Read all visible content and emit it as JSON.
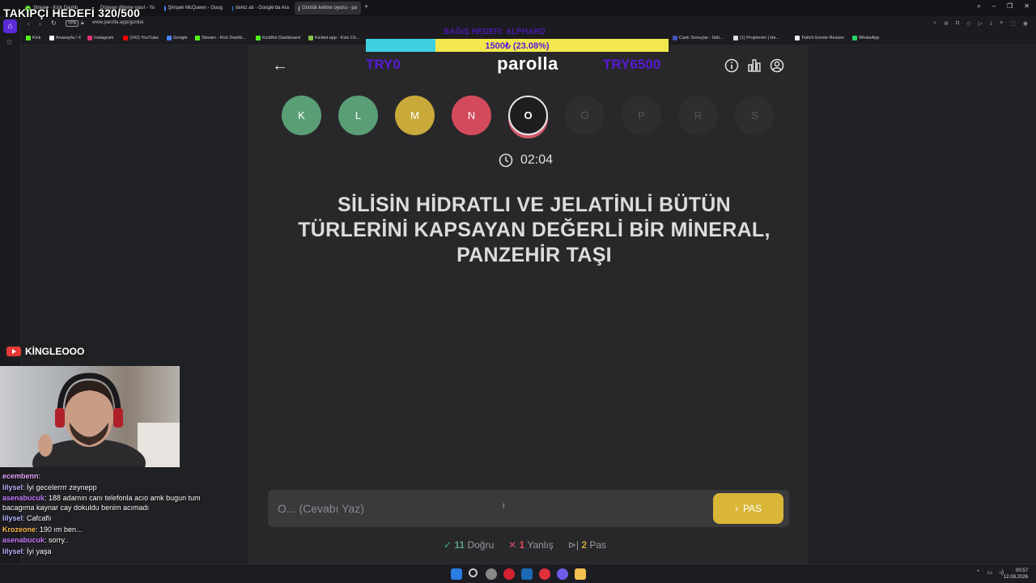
{
  "overlay": {
    "follow_goal": "TAKİPÇİ HEDEFİ 320/500",
    "donation_title": "BAĞIŞ HEDEFİ: ALPHARD",
    "donation_text": "1500₺ (23.08%)",
    "donation_progress": 0.2308,
    "channel_name": "KİNGLEOOO"
  },
  "browser": {
    "tabs": [
      {
        "title": "Stream - Kick Dashb"
      },
      {
        "title": "Dünyan dönme nasıl - Yo"
      },
      {
        "title": "Şimşek McQueen - Goog"
      },
      {
        "title": "deniz atı - Google'da Ara"
      },
      {
        "title": "Günlük kelime oyunu - pa",
        "active": true
      }
    ],
    "vpn": "VPN",
    "url": "www.parolla.app/gunluk",
    "bookmarks": [
      {
        "label": "Kick",
        "color": "#53fc18"
      },
      {
        "label": "Anasayfa / X",
        "color": "#ffffff"
      },
      {
        "label": "Instagram",
        "color": "#e1306c"
      },
      {
        "label": "(242) YouTube",
        "color": "#ff0000"
      },
      {
        "label": "Google",
        "color": "#4285f4"
      },
      {
        "label": "Stream - Kick Dashb...",
        "color": "#53fc18"
      },
      {
        "label": "KickBot Dashboard",
        "color": "#53fc18"
      },
      {
        "label": "Kicklet.app - Kick Ch...",
        "color": "#8bc34a"
      },
      {
        "label": "Canlı Sonuçlar - İddi...",
        "color": "#3f51b5"
      },
      {
        "label": "(1) Projelerim | He...",
        "color": "#dddddd"
      },
      {
        "label": "Twitch Emote Resizer",
        "color": "#eeeeee"
      },
      {
        "label": "WhatsApp",
        "color": "#25d366"
      }
    ]
  },
  "game": {
    "logo": "parolla",
    "try_left": "TRY0",
    "try_right": "TRY6500",
    "letters": [
      {
        "char": "K",
        "state": "green"
      },
      {
        "char": "L",
        "state": "green"
      },
      {
        "char": "M",
        "state": "yellow"
      },
      {
        "char": "N",
        "state": "red"
      },
      {
        "char": "O",
        "state": "current"
      },
      {
        "char": "Ö",
        "state": "pending"
      },
      {
        "char": "P",
        "state": "pending"
      },
      {
        "char": "R",
        "state": "pending"
      },
      {
        "char": "S",
        "state": "pending"
      }
    ],
    "timer": "02:04",
    "question": "SİLİSİN HİDRATLI VE JELATİNLİ BÜTÜN TÜRLERİNİ KAPSAYAN DEĞERLİ BİR MİNERAL, PANZEHİR TAŞI",
    "answer_placeholder": "O... (Cevabı Yaz)",
    "pas_label": "PAS",
    "stats": {
      "correct_count": "11",
      "correct_label": "Doğru",
      "wrong_count": "1",
      "wrong_label": "Yanlış",
      "pass_count": "2",
      "pass_label": "Pas"
    }
  },
  "chat": [
    {
      "user": "ecembenn",
      "message": "",
      "color": "#e6a6ff"
    },
    {
      "user": "lilysel",
      "message": "İyi gecelerrrr zeynepp",
      "color": "#b5b5ff"
    },
    {
      "user": "asenabucuk",
      "message": "188 adamın canı telefonla acıo amk bugun tum bacagıma kaynar cay dokuldu benim acımadı",
      "color": "#c77dff"
    },
    {
      "user": "lilysel",
      "message": "Cafcaflı",
      "color": "#b5b5ff"
    },
    {
      "user": "Krozeone",
      "message": "190 ım ben...",
      "color": "#ffb84d"
    },
    {
      "user": "asenabucuk",
      "message": "sorry..",
      "color": "#c77dff"
    },
    {
      "user": "lilysel",
      "message": "İyi yaşa",
      "color": "#b5b5ff"
    }
  ],
  "taskbar": {
    "time": "00:57",
    "date": "12.08.2026"
  }
}
